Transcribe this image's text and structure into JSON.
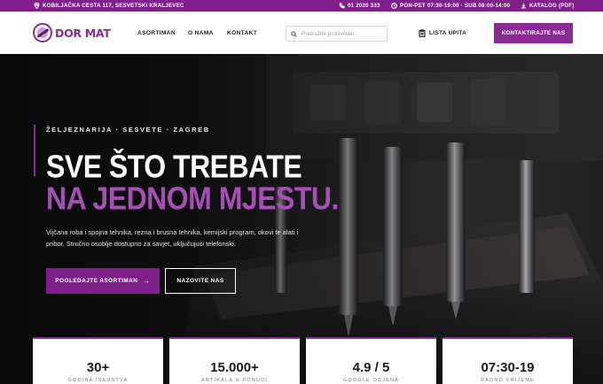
{
  "topbar": {
    "address": "KOBILJAČKA CESTA 117, SESVETSKI KRALJEVEC",
    "phone": "01 2020 333",
    "hours": "PON-PET 07:30-19:00 · SUB 08:00-14:00",
    "catalog": "KATALOG (PDF)"
  },
  "header": {
    "logo_text": "DOR MAT",
    "nav": [
      "ASORTIMAN",
      "O NAMA",
      "KONTAKT"
    ],
    "search_placeholder": "Pretražite proizvode...",
    "list_label": "LISTA UPITA",
    "cta_label": "KONTAKTIRAJTE NAS"
  },
  "hero": {
    "eyebrow": "ŽELJEZNARIJA · SESVETE · ZAGREB",
    "title_line1": "SVE ŠTO TREBATE",
    "title_line2": "NA JEDNOM MJESTU.",
    "lead": "Vijčana roba i spojna tehnika, rezna i brusna tehnika, kemijski program, okovi te alati i pribor. Stručno osoblje dostupno za savjet, uključujući telefonski.",
    "primary_button": "POGLEDAJTE ASORTIMAN",
    "primary_arrow": "→",
    "secondary_button": "NAZOVITE NAS"
  },
  "stats": [
    {
      "value": "30+",
      "label": "GODINA ISKUSTVA"
    },
    {
      "value": "15.000+",
      "label": "ARTIKALA U PONUDI"
    },
    {
      "value": "4.9 / 5",
      "label": "GOOGLE OCJENA"
    },
    {
      "value": "07:30-19",
      "label": "RADNO VRIJEME"
    }
  ],
  "colors": {
    "brand": "#8b2a96",
    "brand_dark": "#7e1f8c",
    "accent_text": "#a64fb4"
  }
}
